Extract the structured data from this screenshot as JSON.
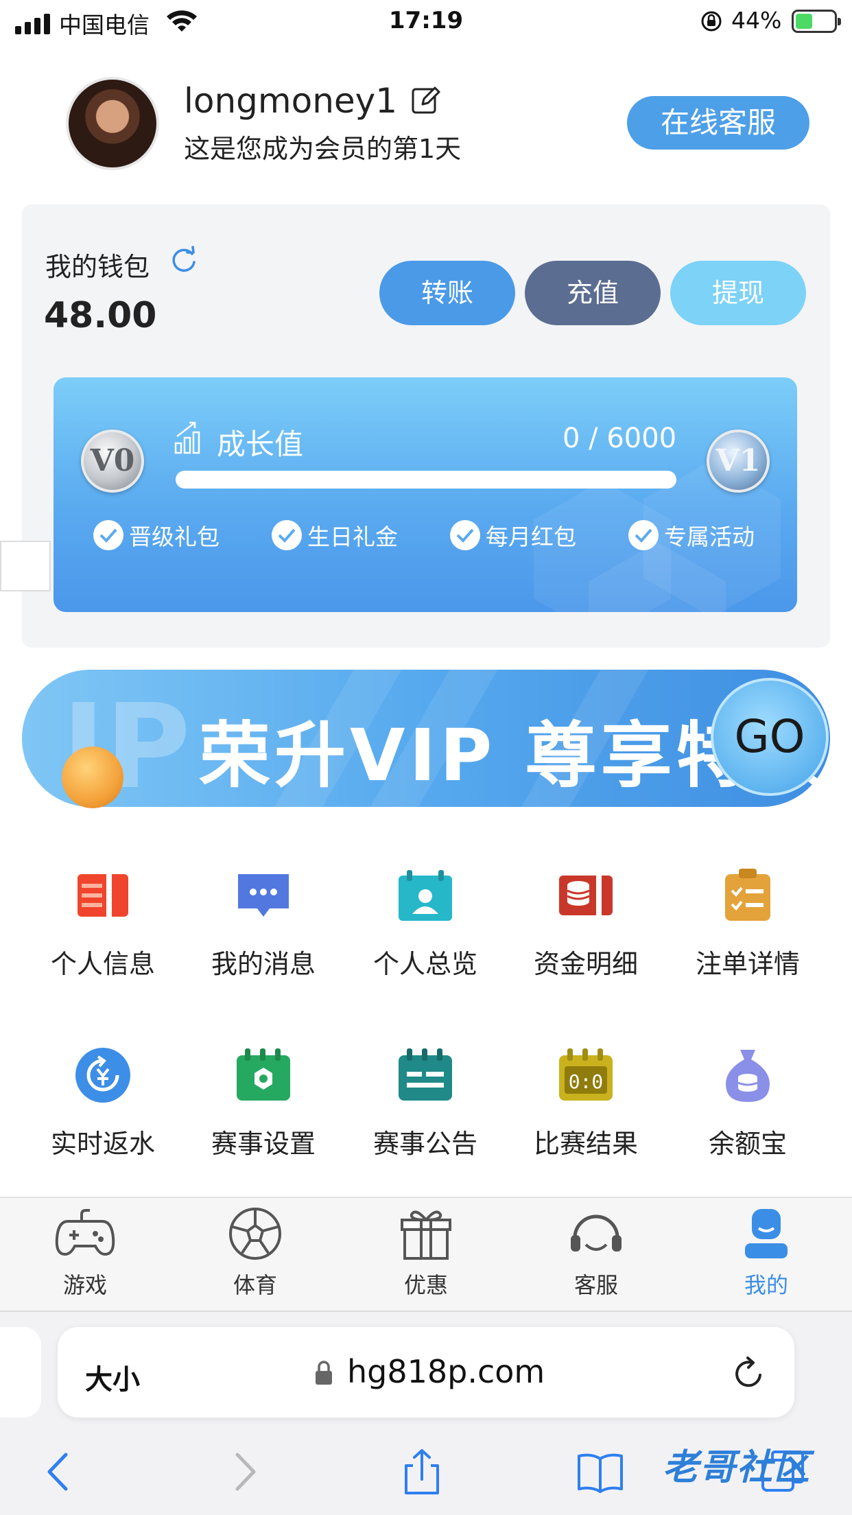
{
  "status_bar": {
    "carrier": "中国电信",
    "time": "17:19",
    "battery_percent": "44%",
    "battery_level": 0.44
  },
  "profile": {
    "username": "longmoney1",
    "member_days": "这是您成为会员的第1天",
    "online_service": "在线客服"
  },
  "wallet": {
    "label": "我的钱包",
    "balance": "48.00",
    "buttons": {
      "transfer": "转账",
      "deposit": "充值",
      "withdraw": "提现"
    }
  },
  "growth": {
    "title": "成长值",
    "progress_text": "0 / 6000",
    "progress_value": 0,
    "progress_max": 6000,
    "level_current": "V0",
    "level_next": "V1",
    "perks": [
      "晋级礼包",
      "生日礼金",
      "每月红包",
      "专属活动"
    ]
  },
  "vip_banner": {
    "text": "荣升VIP 尊享特权",
    "go": "GO",
    "bg_letters": "IP"
  },
  "menu": [
    {
      "label": "个人信息",
      "icon": "id-card-icon",
      "color": "#f0452c"
    },
    {
      "label": "我的消息",
      "icon": "message-icon",
      "color": "#5278e0"
    },
    {
      "label": "个人总览",
      "icon": "profile-calendar-icon",
      "color": "#26b7c9"
    },
    {
      "label": "资金明细",
      "icon": "funds-icon",
      "color": "#c9372a"
    },
    {
      "label": "注单详情",
      "icon": "clipboard-icon",
      "color": "#e3a33a"
    },
    {
      "label": "实时返水",
      "icon": "rebate-icon",
      "color": "#3d8ee6"
    },
    {
      "label": "赛事设置",
      "icon": "event-settings-icon",
      "color": "#25a85f"
    },
    {
      "label": "赛事公告",
      "icon": "announcement-icon",
      "color": "#1f8a88"
    },
    {
      "label": "比赛结果",
      "icon": "score-icon",
      "color": "#c9b21e"
    },
    {
      "label": "余额宝",
      "icon": "money-bag-icon",
      "color": "#8a8fe8"
    }
  ],
  "tabs": [
    {
      "label": "游戏",
      "icon": "gamepad-icon"
    },
    {
      "label": "体育",
      "icon": "soccer-ball-icon"
    },
    {
      "label": "优惠",
      "icon": "gift-icon"
    },
    {
      "label": "客服",
      "icon": "headset-icon"
    },
    {
      "label": "我的",
      "icon": "user-icon",
      "active": true
    }
  ],
  "browser": {
    "text_size": "大小",
    "url": "hg818p.com"
  },
  "watermark": "老哥社区",
  "colors": {
    "accent": "#4d9fe8",
    "active_tab": "#3b8ee6"
  }
}
